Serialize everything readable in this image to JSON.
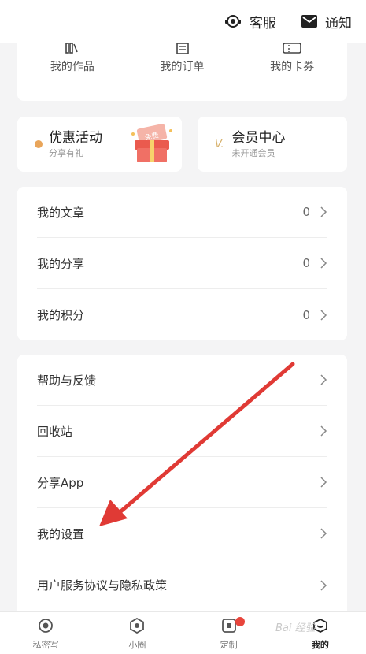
{
  "topbar": {
    "service_label": "客服",
    "notify_label": "通知"
  },
  "quick_links": [
    {
      "label": "我的作品",
      "icon": "book-icon"
    },
    {
      "label": "我的订单",
      "icon": "order-icon"
    },
    {
      "label": "我的卡券",
      "icon": "coupon-icon"
    }
  ],
  "promo": {
    "left": {
      "title": "优惠活动",
      "subtitle": "分享有礼",
      "gift_text": "免费"
    },
    "right": {
      "title": "会员中心",
      "subtitle": "未开通会员",
      "vip_mark": "V."
    }
  },
  "stats_list": [
    {
      "label": "我的文章",
      "count": "0"
    },
    {
      "label": "我的分享",
      "count": "0"
    },
    {
      "label": "我的积分",
      "count": "0"
    }
  ],
  "menu_list": [
    {
      "label": "帮助与反馈"
    },
    {
      "label": "回收站"
    },
    {
      "label": "分享App"
    },
    {
      "label": "我的设置"
    },
    {
      "label": "用户服务协议与隐私政策"
    }
  ],
  "tabs": [
    {
      "label": "私密写",
      "icon": "circle-dot-icon"
    },
    {
      "label": "小圈",
      "icon": "hexagon-icon"
    },
    {
      "label": "定制",
      "icon": "square-dot-icon"
    },
    {
      "label": "我的",
      "icon": "smile-icon"
    }
  ],
  "watermark": "Bai 经验",
  "colors": {
    "arrow": "#e03a35",
    "badge": "#e8453c",
    "gift_accent": "#f07065"
  }
}
